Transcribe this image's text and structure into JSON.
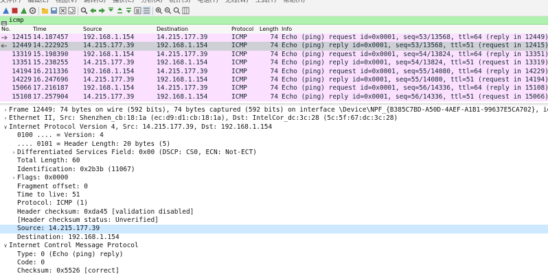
{
  "menu": [
    "文件(F)",
    "编辑(E)",
    "视图(V)",
    "跳转(G)",
    "捕获(C)",
    "分析(A)",
    "统计(S)",
    "电话(Y)",
    "无线(W)",
    "工具(T)",
    "帮助(H)"
  ],
  "filter": {
    "value": "icmp"
  },
  "columns": {
    "no": "No.",
    "time": "Time",
    "source": "Source",
    "destination": "Destination",
    "protocol": "Protocol",
    "length": "Length",
    "info": "Info"
  },
  "packets": [
    {
      "no": "12415",
      "time": "14.187457",
      "source": "192.168.1.154",
      "destination": "14.215.177.39",
      "protocol": "ICMP",
      "length": "74",
      "info": "Echo (ping) request  id=0x0001, seq=53/13568, ttl=64 (reply in 12449)",
      "marker": "request"
    },
    {
      "no": "12449",
      "time": "14.222925",
      "source": "14.215.177.39",
      "destination": "192.168.1.154",
      "protocol": "ICMP",
      "length": "74",
      "info": "Echo (ping) reply    id=0x0001, seq=53/13568, ttl=51 (request in 12415)",
      "marker": "reply",
      "selected": true
    },
    {
      "no": "13319",
      "time": "15.198390",
      "source": "192.168.1.154",
      "destination": "14.215.177.39",
      "protocol": "ICMP",
      "length": "74",
      "info": "Echo (ping) request  id=0x0001, seq=54/13824, ttl=64 (reply in 13351)"
    },
    {
      "no": "13351",
      "time": "15.238255",
      "source": "14.215.177.39",
      "destination": "192.168.1.154",
      "protocol": "ICMP",
      "length": "74",
      "info": "Echo (ping) reply    id=0x0001, seq=54/13824, ttl=51 (request in 13319)"
    },
    {
      "no": "14194",
      "time": "16.211336",
      "source": "192.168.1.154",
      "destination": "14.215.177.39",
      "protocol": "ICMP",
      "length": "74",
      "info": "Echo (ping) request  id=0x0001, seq=55/14080, ttl=64 (reply in 14229)"
    },
    {
      "no": "14229",
      "time": "16.247696",
      "source": "14.215.177.39",
      "destination": "192.168.1.154",
      "protocol": "ICMP",
      "length": "74",
      "info": "Echo (ping) reply    id=0x0001, seq=55/14080, ttl=51 (request in 14194)"
    },
    {
      "no": "15066",
      "time": "17.216187",
      "source": "192.168.1.154",
      "destination": "14.215.177.39",
      "protocol": "ICMP",
      "length": "74",
      "info": "Echo (ping) request  id=0x0001, seq=56/14336, ttl=64 (reply in 15108)"
    },
    {
      "no": "15108",
      "time": "17.257904",
      "source": "14.215.177.39",
      "destination": "192.168.1.154",
      "protocol": "ICMP",
      "length": "74",
      "info": "Echo (ping) reply    id=0x0001, seq=56/14336, ttl=51 (request in 15066)"
    }
  ],
  "details": [
    {
      "indent": 0,
      "expander": "collapsed",
      "text": "Frame 12449: 74 bytes on wire (592 bits), 74 bytes captured (592 bits) on interface \\Device\\NPF_{B385C7BD-A50D-4AEF-A1B1-99637E5CA702}, id 0"
    },
    {
      "indent": 0,
      "expander": "collapsed",
      "text": "Ethernet II, Src: Shenzhen_cb:18:1a (ec:d9:d1:cb:18:1a), Dst: IntelCor_dc:3c:28 (5c:5f:67:dc:3c:28)"
    },
    {
      "indent": 0,
      "expander": "expanded",
      "text": "Internet Protocol Version 4, Src: 14.215.177.39, Dst: 192.168.1.154"
    },
    {
      "indent": 1,
      "expander": "none",
      "text": "0100 .... = Version: 4"
    },
    {
      "indent": 1,
      "expander": "none",
      "text": ".... 0101 = Header Length: 20 bytes (5)"
    },
    {
      "indent": 1,
      "expander": "collapsed",
      "text": "Differentiated Services Field: 0x00 (DSCP: CS0, ECN: Not-ECT)"
    },
    {
      "indent": 1,
      "expander": "none",
      "text": "Total Length: 60"
    },
    {
      "indent": 1,
      "expander": "none",
      "text": "Identification: 0x2b3b (11067)"
    },
    {
      "indent": 1,
      "expander": "collapsed",
      "text": "Flags: 0x0000"
    },
    {
      "indent": 1,
      "expander": "none",
      "text": "Fragment offset: 0"
    },
    {
      "indent": 1,
      "expander": "none",
      "text": "Time to live: 51"
    },
    {
      "indent": 1,
      "expander": "none",
      "text": "Protocol: ICMP (1)"
    },
    {
      "indent": 1,
      "expander": "none",
      "text": "Header checksum: 0xda45 [validation disabled]"
    },
    {
      "indent": 1,
      "expander": "none",
      "text": "[Header checksum status: Unverified]"
    },
    {
      "indent": 1,
      "expander": "none",
      "text": "Source: 14.215.177.39",
      "highlight": true
    },
    {
      "indent": 1,
      "expander": "none",
      "text": "Destination: 192.168.1.154"
    },
    {
      "indent": 0,
      "expander": "expanded",
      "text": "Internet Control Message Protocol"
    },
    {
      "indent": 1,
      "expander": "none",
      "text": "Type: 0 (Echo (ping) reply)"
    },
    {
      "indent": 1,
      "expander": "none",
      "text": "Code: 0"
    },
    {
      "indent": 1,
      "expander": "none",
      "text": "Checksum: 0x5526 [correct]"
    }
  ],
  "colors": {
    "row_icmp": "#fce0ff",
    "row_selected": "#cfcfd6",
    "filter_ok": "#aff2af",
    "detail_highlight": "#cde8ff"
  }
}
